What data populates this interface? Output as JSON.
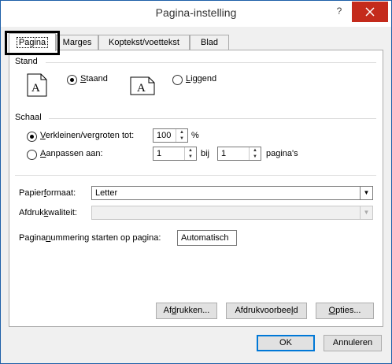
{
  "window": {
    "title": "Pagina-instelling",
    "help": "?"
  },
  "tabs": [
    {
      "label": "Pagina"
    },
    {
      "label": "Marges"
    },
    {
      "label": "Koptekst/voettekst"
    },
    {
      "label": "Blad"
    }
  ],
  "orientation": {
    "heading": "Stand",
    "portrait_pre": "",
    "portrait_u": "S",
    "portrait_post": "taand",
    "landscape_pre": "",
    "landscape_u": "L",
    "landscape_post": "iggend",
    "icon_letter": "A",
    "selected": "portrait"
  },
  "scaling": {
    "heading": "Schaal",
    "adjust_pre": "",
    "adjust_u": "V",
    "adjust_post": "erkleinen/vergroten tot:",
    "adjust_value": "100",
    "percent": "%",
    "fit_pre": "",
    "fit_u": "A",
    "fit_post": "anpassen aan:",
    "fit_wide": "1",
    "by": "bij",
    "fit_tall": "1",
    "pages": "pagina's",
    "selected": "adjust"
  },
  "paper": {
    "size_pre": "Papier",
    "size_u": "f",
    "size_post": "ormaat:",
    "size_value": "Letter",
    "quality_pre": "Afdruk",
    "quality_u": "k",
    "quality_post": "waliteit:",
    "quality_value": ""
  },
  "first_page": {
    "pre": "Pagina",
    "u": "n",
    "post": "ummering starten op pagina:",
    "value": "Automatisch"
  },
  "buttons": {
    "print_pre": "Af",
    "print_u": "d",
    "print_post": "rukken...",
    "preview_pre": "Afdrukvoorbee",
    "preview_u": "l",
    "preview_post": "d",
    "options_pre": "",
    "options_u": "O",
    "options_post": "pties...",
    "ok": "OK",
    "cancel": "Annuleren"
  },
  "colors": {
    "highlight_box": "#000000",
    "close_button": "#c42b1c",
    "accent": "#0078d7"
  }
}
